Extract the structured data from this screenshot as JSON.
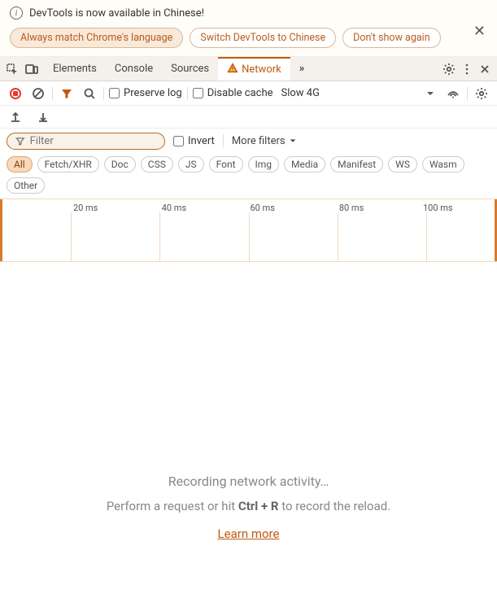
{
  "infobar": {
    "message": "DevTools is now available in Chinese!",
    "btn_match": "Always match Chrome's language",
    "btn_switch": "Switch DevTools to Chinese",
    "btn_dont_show": "Don't show again"
  },
  "main_tabs": {
    "items": [
      "Elements",
      "Console",
      "Sources",
      "Network"
    ],
    "active_index": 3,
    "more_glyph": "»"
  },
  "net_toolbar": {
    "preserve_log": "Preserve log",
    "disable_cache": "Disable cache",
    "throttling": "Slow 4G"
  },
  "filter": {
    "placeholder": "Filter",
    "invert": "Invert",
    "more_filters": "More filters"
  },
  "type_pills": [
    "All",
    "Fetch/XHR",
    "Doc",
    "CSS",
    "JS",
    "Font",
    "Img",
    "Media",
    "Manifest",
    "WS",
    "Wasm",
    "Other"
  ],
  "type_pills_active_index": 0,
  "timeline_ticks": [
    "20 ms",
    "40 ms",
    "60 ms",
    "80 ms",
    "100 ms"
  ],
  "empty": {
    "title": "Recording network activity…",
    "line_a": "Perform a request or hit",
    "shortcut": "Ctrl + R",
    "line_b": "to record the reload.",
    "learn_more": "Learn more"
  }
}
